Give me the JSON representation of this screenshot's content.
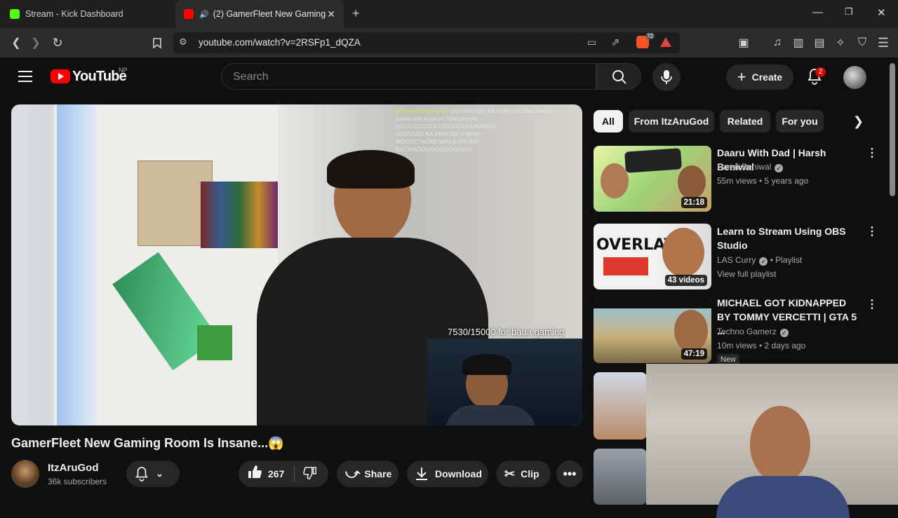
{
  "browser": {
    "tabs": [
      {
        "title": "Stream - Kick Dashboard",
        "favicon_color": "#53fc18"
      },
      {
        "title": "(2) GamerFleet New Gaming",
        "favicon_color": "#ff0000"
      }
    ],
    "url": "youtube.com/watch?v=2RSFp1_dQZA",
    "brave_badge": "72"
  },
  "youtube": {
    "logo_text": "YouTube",
    "country_code": "NP",
    "search_placeholder": "Search",
    "create_label": "Create",
    "notification_count": "2"
  },
  "video": {
    "chat_lines": [
      {
        "name": "@AdityaSingh-gx1ol",
        "text": "pal chemistry ka exam hai bhai please"
      },
      {
        "name": "",
        "text": "paata doo kuch yrr bhai please"
      },
      {
        "name": "",
        "text": "UCCCCCCCCCOOOOOOOUNNNSS"
      },
      {
        "name": "",
        "text": "SSSSSSS KA PAPERR H BHAI"
      },
      {
        "name": "",
        "text": "NOOOO HONE WALA HAI RAI"
      },
      {
        "name": "",
        "text": "BACHAOOOOOOOOOOOO"
      }
    ],
    "goal_text": "7530/15000 for baua gaming",
    "title": "GamerFleet New Gaming Room Is Insane...😱",
    "channel_name": "ItzAruGod",
    "subscribers": "36k subscribers",
    "likes": "267",
    "share_label": "Share",
    "download_label": "Download",
    "clip_label": "Clip"
  },
  "sidebar": {
    "chips": [
      "All",
      "From ItzAruGod",
      "Related",
      "For you"
    ],
    "recommendations": [
      {
        "title": "Daaru With Dad | Harsh Beniwal",
        "channel": "Harsh Beniwal",
        "meta": "55m views • 5 years ago",
        "duration": "21:18"
      },
      {
        "title": "Learn to Stream Using OBS Studio",
        "channel": "LAS Curry",
        "channel_suffix": "• Playlist",
        "meta": "View full playlist",
        "duration": "43 videos"
      },
      {
        "title": "MICHAEL GOT KIDNAPPED BY TOMMY VERCETTI | GTA 5 ...",
        "channel": "Techno Gamerz",
        "meta": "10m views • 2 days ago",
        "duration": "47:19",
        "tag": "New"
      }
    ]
  },
  "colors": {
    "brand_red": "#ff0000",
    "kick_green": "#53fc18",
    "bg": "#0f0f0f"
  }
}
